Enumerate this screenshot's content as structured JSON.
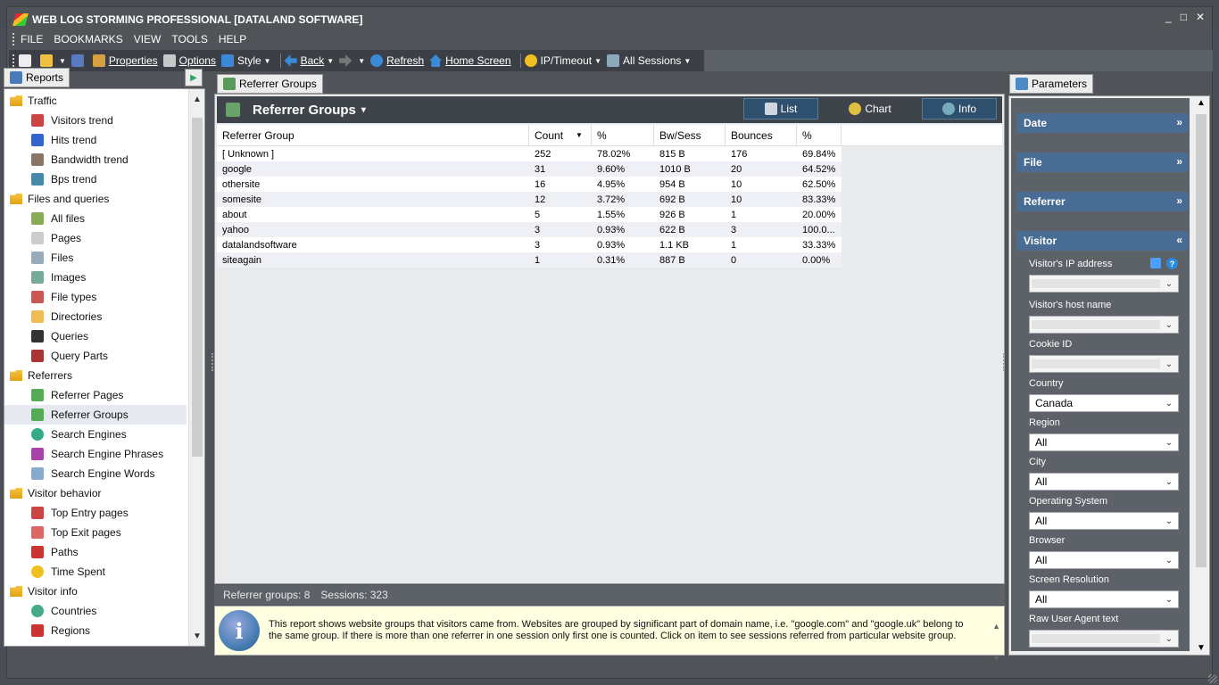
{
  "window": {
    "title": "WEB LOG STORMING PROFESSIONAL [DATALAND SOFTWARE]",
    "controls": [
      "_",
      "□",
      "✕"
    ]
  },
  "menu": [
    "FILE",
    "BOOKMARKS",
    "VIEW",
    "TOOLS",
    "HELP"
  ],
  "toolbar": {
    "properties": "Properties",
    "options": "Options",
    "style": "Style",
    "back": "Back",
    "refresh": "Refresh",
    "home": "Home Screen",
    "iptimeout": "IP/Timeout",
    "sessions": "All Sessions"
  },
  "left_panel": {
    "tab": "Reports",
    "groups": [
      {
        "label": "Traffic",
        "items": [
          "Visitors trend",
          "Hits trend",
          "Bandwidth trend",
          "Bps trend"
        ]
      },
      {
        "label": "Files and queries",
        "items": [
          "All files",
          "Pages",
          "Files",
          "Images",
          "File types",
          "Directories",
          "Queries",
          "Query Parts"
        ]
      },
      {
        "label": "Referrers",
        "items": [
          "Referrer Pages",
          "Referrer Groups",
          "Search Engines",
          "Search Engine Phrases",
          "Search Engine Words"
        ]
      },
      {
        "label": "Visitor behavior",
        "items": [
          "Top Entry pages",
          "Top Exit pages",
          "Paths",
          "Time Spent"
        ]
      },
      {
        "label": "Visitor info",
        "items": [
          "Countries",
          "Regions"
        ]
      }
    ],
    "selected": "Referrer Groups"
  },
  "center": {
    "tab": "Referrer Groups",
    "title": "Referrer Groups",
    "views": [
      "List",
      "Chart",
      "Info"
    ],
    "columns": [
      "Referrer Group",
      "Count",
      "%",
      "Bw/Sess",
      "Bounces",
      "%"
    ],
    "rows": [
      [
        "[ Unknown ]",
        "252",
        "78.02%",
        "815 B",
        "176",
        "69.84%"
      ],
      [
        "google",
        "31",
        "9.60%",
        "1010 B",
        "20",
        "64.52%"
      ],
      [
        "othersite",
        "16",
        "4.95%",
        "954 B",
        "10",
        "62.50%"
      ],
      [
        "somesite",
        "12",
        "3.72%",
        "692 B",
        "10",
        "83.33%"
      ],
      [
        "about",
        "5",
        "1.55%",
        "926 B",
        "1",
        "20.00%"
      ],
      [
        "yahoo",
        "3",
        "0.93%",
        "622 B",
        "3",
        "100.0..."
      ],
      [
        "datalandsoftware",
        "3",
        "0.93%",
        "1.1 KB",
        "1",
        "33.33%"
      ],
      [
        "siteagain",
        "1",
        "0.31%",
        "887 B",
        "0",
        "0.00%"
      ]
    ],
    "status": {
      "groups": "Referrer groups: 8",
      "sessions": "Sessions: 323"
    },
    "info_text": "This report shows website groups that visitors came from. Websites are grouped by significant part of domain name, i.e. \"google.com\" and \"google.uk\" belong to the same group. If there is more than one referrer in one session only first one is counted. Click on item to see sessions referred from particular website group."
  },
  "right_panel": {
    "tab": "Parameters",
    "sections": [
      "Date",
      "File",
      "Referrer",
      "Visitor"
    ],
    "fields": [
      {
        "label": "Visitor's IP address",
        "value": ""
      },
      {
        "label": "Visitor's host name",
        "value": ""
      },
      {
        "label": "Cookie ID",
        "value": ""
      },
      {
        "label": "Country",
        "value": "Canada"
      },
      {
        "label": "Region",
        "value": "All"
      },
      {
        "label": "City",
        "value": "All"
      },
      {
        "label": "Operating System",
        "value": "All"
      },
      {
        "label": "Browser",
        "value": "All"
      },
      {
        "label": "Screen Resolution",
        "value": "All"
      },
      {
        "label": "Raw User Agent text",
        "value": ""
      }
    ]
  },
  "colors": {
    "chrome": "#4a4f57",
    "section": "#486c94",
    "active_view": "#2f4f6e",
    "info_bg": "#fefee0"
  }
}
